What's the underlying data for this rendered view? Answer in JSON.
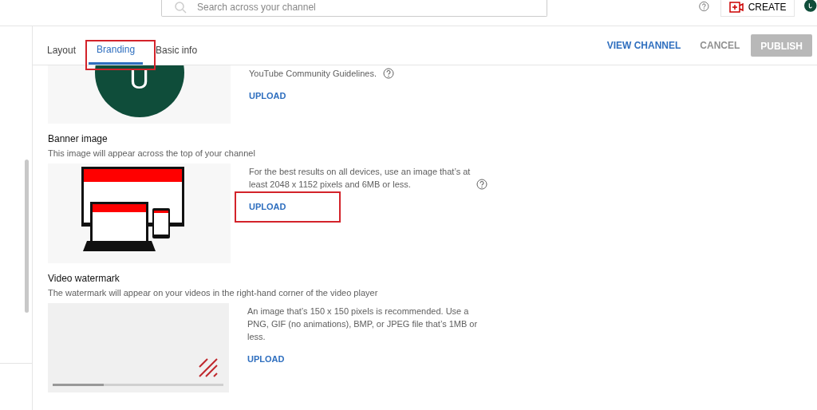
{
  "search": {
    "placeholder": "Search across your channel"
  },
  "header": {
    "create_label": "CREATE"
  },
  "tabs": [
    {
      "label": "Layout",
      "selected": false,
      "annotated": false
    },
    {
      "label": "Branding",
      "selected": true,
      "annotated": true
    },
    {
      "label": "Basic info",
      "selected": false,
      "annotated": false
    }
  ],
  "actions": [
    {
      "label": "VIEW CHANNEL",
      "kind": "link",
      "disabled": false
    },
    {
      "label": "CANCEL",
      "kind": "text",
      "disabled": false
    },
    {
      "label": "PUBLISH",
      "kind": "filled",
      "disabled": true
    }
  ],
  "sections": [
    {
      "kind": "picture",
      "avatar_letter": "U",
      "info": [
        "YouTube Community Guidelines."
      ],
      "info_help": true,
      "upload": "UPLOAD",
      "annotated": false
    },
    {
      "kind": "banner",
      "title": "Banner image",
      "description": "This image will appear across the top of your channel",
      "info": [
        "For the best results on all devices, use an image that’s at",
        "least 2048 x 1152 pixels and 6MB or less."
      ],
      "info_help": true,
      "upload": "UPLOAD",
      "annotated": true
    },
    {
      "kind": "watermark",
      "title": "Video watermark",
      "description": "The watermark will appear on your videos in the right-hand corner of the video player",
      "info": [
        "An image that’s 150 x 150 pixels is recommended. Use a",
        "PNG, GIF (no animations), BMP, or JPEG file that’s 1MB or",
        "less."
      ],
      "info_help": false,
      "upload": "UPLOAD",
      "annotated": false
    }
  ]
}
